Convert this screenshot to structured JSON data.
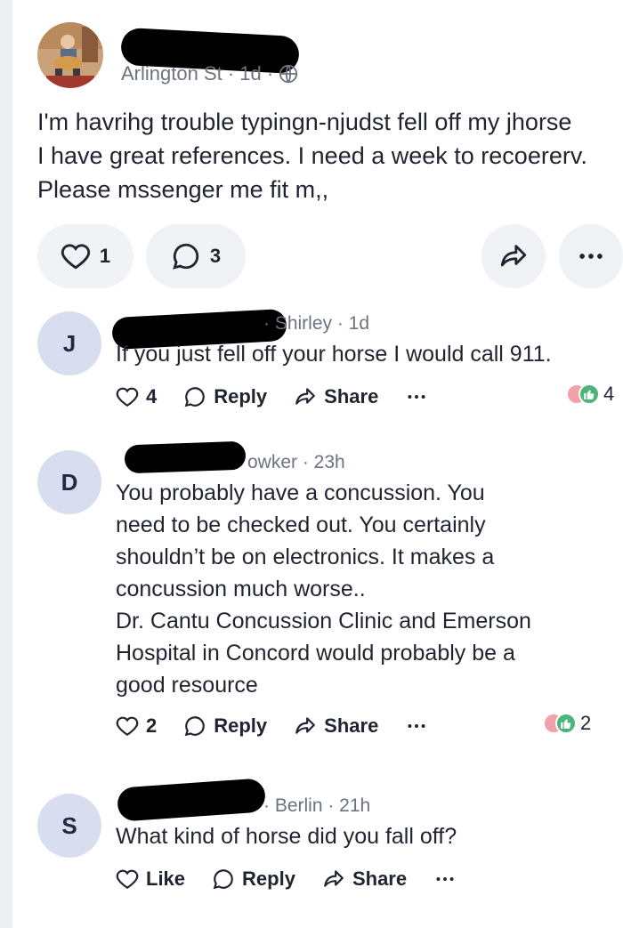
{
  "post": {
    "meta": "Arlington St · 1d ·",
    "body_lines": [
      "I'm havrihg trouble typingn-njudst fell off my jhorse",
      "I have great references. I need a week to recoererv.",
      "Please mssenger me fit m,,"
    ],
    "like_count": "1",
    "comment_count": "3",
    "icons": {
      "like": "heart-icon",
      "comment": "speech-bubble-icon",
      "share": "share-arrow-icon",
      "more": "more-dots-icon",
      "audience": "globe-icon"
    }
  },
  "comments": [
    {
      "initial": "J",
      "meta": "· Shirley · 1d",
      "text": [
        "If you just fell off your horse I would call 911."
      ],
      "like_label": "4",
      "reply_label": "Reply",
      "share_label": "Share",
      "reaction_count": "4"
    },
    {
      "initial": "D",
      "meta": "owker · 23h",
      "text": [
        "You probably have a concussion. You",
        "need to be checked out. You certainly",
        "shouldn’t be on electronics. It makes a",
        "concussion much worse..",
        "Dr. Cantu Concussion Clinic and Emerson",
        "Hospital in Concord would probably be a",
        "good resource"
      ],
      "like_label": "2",
      "reply_label": "Reply",
      "share_label": "Share",
      "reaction_count": "2"
    },
    {
      "initial": "S",
      "meta": "· Berlin · 21h",
      "text": [
        "What kind of horse did you fall off?"
      ],
      "like_label": "Like",
      "reply_label": "Reply",
      "share_label": "Share"
    }
  ],
  "colors": {
    "pill_bg": "#f1f2f5",
    "avatar_bg": "#d8def0",
    "meta_text": "#6b7280",
    "reaction_love": "#f3a1a8",
    "reaction_thumb": "#4cb37a"
  }
}
